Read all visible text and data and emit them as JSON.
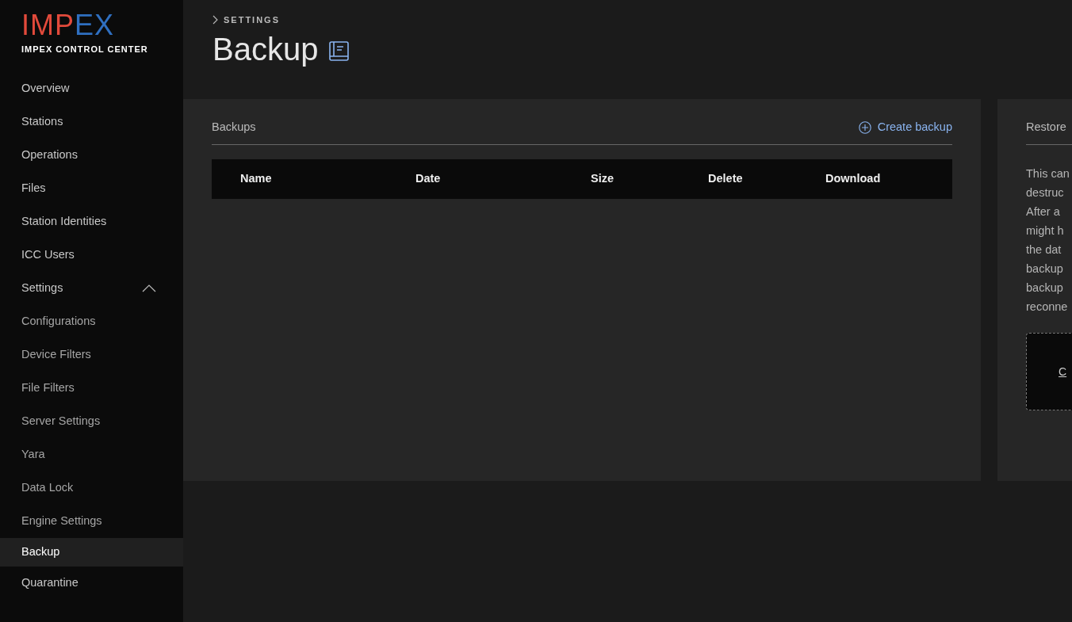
{
  "logo": {
    "brand": "IMPEX",
    "subtitle": "IMPEX CONTROL CENTER"
  },
  "sidebar": {
    "items": [
      {
        "label": "Overview",
        "selected": false
      },
      {
        "label": "Stations",
        "selected": false
      },
      {
        "label": "Operations",
        "selected": false
      },
      {
        "label": "Files",
        "selected": false
      },
      {
        "label": "Station Identities",
        "selected": false
      },
      {
        "label": "ICC Users",
        "selected": false
      },
      {
        "label": "Settings",
        "selected": false,
        "expanded": true,
        "children": [
          {
            "label": "Configurations",
            "selected": false
          },
          {
            "label": "Device Filters",
            "selected": false
          },
          {
            "label": "File Filters",
            "selected": false
          },
          {
            "label": "Server Settings",
            "selected": false
          },
          {
            "label": "Yara",
            "selected": false
          },
          {
            "label": "Data Lock",
            "selected": false
          },
          {
            "label": "Engine Settings",
            "selected": false
          },
          {
            "label": "Backup",
            "selected": true
          }
        ]
      },
      {
        "label": "Quarantine",
        "selected": false
      }
    ]
  },
  "breadcrumb": "SETTINGS",
  "title": "Backup",
  "backups": {
    "title": "Backups",
    "create_button": "Create backup",
    "table": {
      "columns": [
        "Name",
        "Date",
        "Size",
        "Delete",
        "Download"
      ]
    }
  },
  "restore": {
    "title": "Restore",
    "lines": [
      "This can",
      "destruc",
      "After a",
      "might h",
      "the dat",
      "backup",
      "backup",
      "reconne"
    ],
    "drop_link": "C"
  }
}
